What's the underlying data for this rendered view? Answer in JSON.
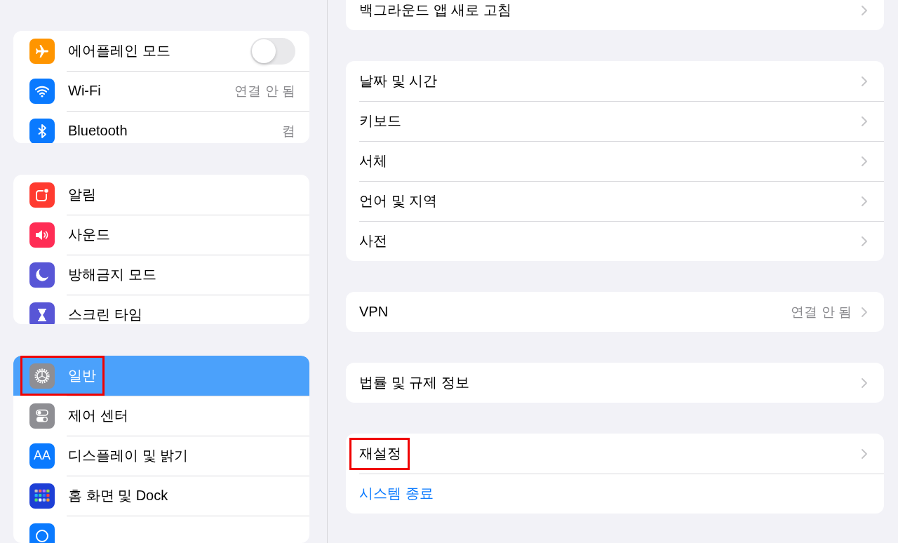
{
  "sidebar": {
    "groups": [
      {
        "items": [
          {
            "label": "에어플레인 모드",
            "kind": "toggle",
            "on": false,
            "selected": false,
            "highlighted": false
          },
          {
            "label": "Wi-Fi",
            "kind": "value",
            "value": "연결 안 됨",
            "selected": false,
            "highlighted": false
          },
          {
            "label": "Bluetooth",
            "kind": "value",
            "value": "켬",
            "selected": false,
            "highlighted": false
          }
        ]
      },
      {
        "items": [
          {
            "label": "알림",
            "kind": "plain",
            "selected": false,
            "highlighted": false
          },
          {
            "label": "사운드",
            "kind": "plain",
            "selected": false,
            "highlighted": false
          },
          {
            "label": "방해금지 모드",
            "kind": "plain",
            "selected": false,
            "highlighted": false
          },
          {
            "label": "스크린 타임",
            "kind": "plain",
            "selected": false,
            "highlighted": false
          }
        ]
      },
      {
        "items": [
          {
            "label": "일반",
            "kind": "plain",
            "selected": true,
            "highlighted": true
          },
          {
            "label": "제어 센터",
            "kind": "plain",
            "selected": false,
            "highlighted": false
          },
          {
            "label": "디스플레이 및 밝기",
            "icon_label": "AA",
            "kind": "plain",
            "selected": false,
            "highlighted": false
          },
          {
            "label": "홈 화면 및 Dock",
            "kind": "plain",
            "selected": false,
            "highlighted": false
          },
          {
            "kind": "plain",
            "selected": false,
            "highlighted": false
          }
        ]
      }
    ]
  },
  "detail": {
    "groups": [
      {
        "items": [
          {
            "label": "백그라운드 앱 새로 고침",
            "kind": "link",
            "highlighted": false
          }
        ]
      },
      {
        "items": [
          {
            "label": "날짜 및 시간",
            "kind": "link",
            "highlighted": false
          },
          {
            "label": "키보드",
            "kind": "link",
            "highlighted": false
          },
          {
            "label": "서체",
            "kind": "link",
            "highlighted": false
          },
          {
            "label": "언어 및 지역",
            "kind": "link",
            "highlighted": false
          },
          {
            "label": "사전",
            "kind": "link",
            "highlighted": false
          }
        ]
      },
      {
        "items": [
          {
            "label": "VPN",
            "kind": "link",
            "value": "연결 안 됨",
            "highlighted": false
          }
        ]
      },
      {
        "items": [
          {
            "label": "법률 및 규제 정보",
            "kind": "link",
            "highlighted": false
          }
        ]
      },
      {
        "items": [
          {
            "label": "재설정",
            "kind": "link",
            "highlighted": true
          },
          {
            "label": "시스템 종료",
            "kind": "action",
            "highlighted": false
          }
        ]
      }
    ]
  }
}
